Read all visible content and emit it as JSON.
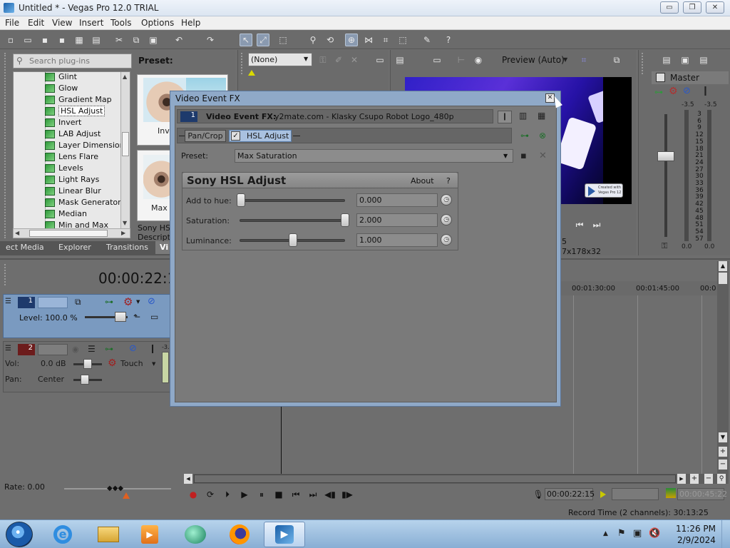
{
  "window": {
    "title": "Untitled * - Vegas Pro 12.0 TRIAL",
    "min_glyph": "▭",
    "max_glyph": "❐",
    "close_glyph": "✕"
  },
  "menu": [
    "File",
    "Edit",
    "View",
    "Insert",
    "Tools",
    "Options",
    "Help"
  ],
  "plugins": {
    "search_placeholder": "Search plug-ins",
    "preset_label": "Preset:",
    "items": [
      "Glint",
      "Glow",
      "Gradient Map",
      "HSL Adjust",
      "Invert",
      "LAB Adjust",
      "Layer Dimensional",
      "Lens Flare",
      "Levels",
      "Light Rays",
      "Linear Blur",
      "Mask Generator",
      "Median",
      "Min and Max"
    ],
    "selected": "HSL Adjust",
    "preview_label_1": "Inv",
    "preview_label_2": "Max S",
    "desc_line1": "Sony HSL",
    "desc_line2": "Descriptio"
  },
  "tabs": [
    "ect Media",
    "Explorer",
    "Transitions",
    "Vi"
  ],
  "trimmer": {
    "dropdown_value": "(None)"
  },
  "preview": {
    "mode": "Preview (Auto)",
    "frame_label": "5",
    "size_label": "7x178x32",
    "watermark_line1": "Created with",
    "watermark_line2": "Vegas Pro 12"
  },
  "master": {
    "title": "Master",
    "peak_left": "-3.5",
    "peak_right": "-3.5",
    "scale": [
      "3",
      "6",
      "9",
      "12",
      "15",
      "18",
      "21",
      "24",
      "27",
      "30",
      "33",
      "36",
      "39",
      "42",
      "45",
      "48",
      "51",
      "54",
      "57"
    ],
    "bottom_left": "0.0",
    "bottom_right": "0.0"
  },
  "timeline": {
    "timecode": "00:00:22:1",
    "ruler": [
      "00:01:30:00",
      "00:01:45:00",
      "00:0"
    ],
    "track1": {
      "num": "1",
      "level": "Level: 100.0 %"
    },
    "track2": {
      "num": "2",
      "vol_label": "Vol:",
      "vol_value": "0.0 dB",
      "pan_label": "Pan:",
      "pan_value": "Center",
      "automation": "Touch",
      "meter_top": "-3.4"
    },
    "rate": "Rate: 0.00"
  },
  "transport": {
    "current_time": "00:00:22:15",
    "end_time": "00:00:45:22",
    "record_time": "Record Time (2 channels): 30:13:25"
  },
  "dialog": {
    "title": "Video Event FX",
    "close_glyph": "✕",
    "header_label": "Video Event FX:",
    "header_value": "y2mate.com - Klasky Csupo Robot Logo_480p",
    "badge": "1",
    "chain": [
      "Pan/Crop",
      "HSL Adjust"
    ],
    "preset_label": "Preset:",
    "preset_value": "Max Saturation",
    "plugin_title": "Sony HSL Adjust",
    "about": "About",
    "help": "?",
    "params": [
      {
        "label": "Add to hue:",
        "value": "0.000",
        "position": 0.0
      },
      {
        "label": "Saturation:",
        "value": "2.000",
        "position": 1.0
      },
      {
        "label": "Luminance:",
        "value": "1.000",
        "position": 0.5
      }
    ]
  },
  "clock": {
    "time": "11:26 PM",
    "date": "2/9/2024"
  }
}
